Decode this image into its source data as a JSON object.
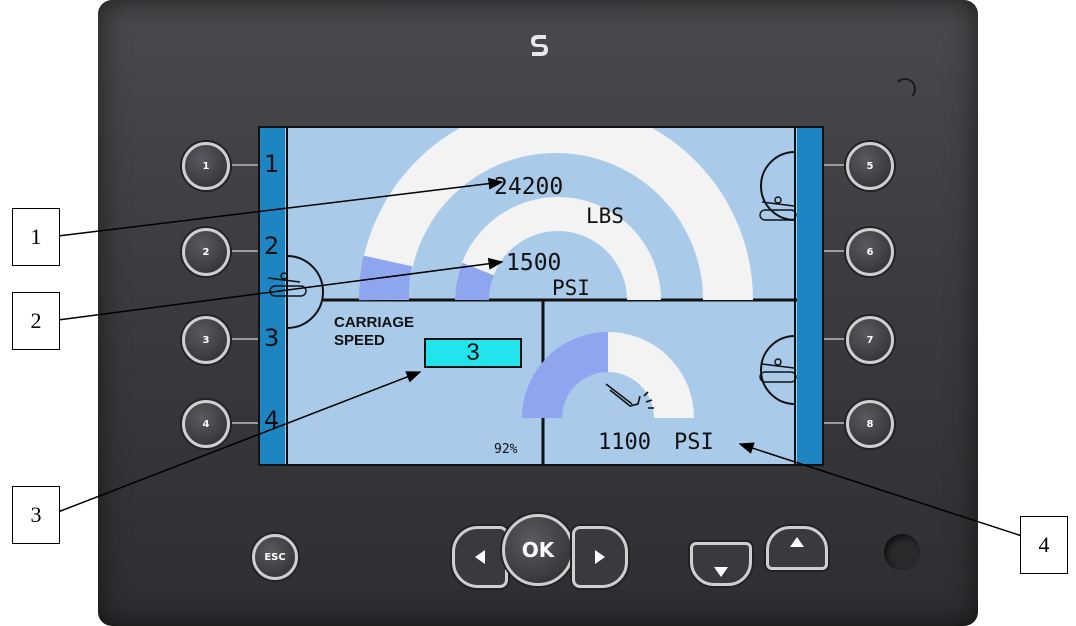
{
  "side_buttons_left": [
    "1",
    "2",
    "3",
    "4"
  ],
  "side_buttons_right": [
    "5",
    "6",
    "7",
    "8"
  ],
  "screen": {
    "left_numbers": [
      "1",
      "2",
      "3",
      "4"
    ],
    "load_value": "24200",
    "load_unit": "LBS",
    "pressure_value": "1500",
    "pressure_unit": "PSI",
    "carriage_label_line1": "CARRIAGE",
    "carriage_label_line2": "SPEED",
    "carriage_speed_value": "3",
    "percent": "92%",
    "hydraulic_value": "1100",
    "hydraulic_unit": "PSI"
  },
  "bottom_buttons": {
    "esc": "ESC",
    "ok": "OK"
  },
  "callouts": [
    "1",
    "2",
    "3",
    "4"
  ],
  "colors": {
    "screen_bg": "#a9cbe9",
    "side_bar": "#1d86c2",
    "gauge_fill": "#f3f3f3",
    "gauge_low": "#8ea6f0",
    "speed_box": "#22e4ec"
  }
}
